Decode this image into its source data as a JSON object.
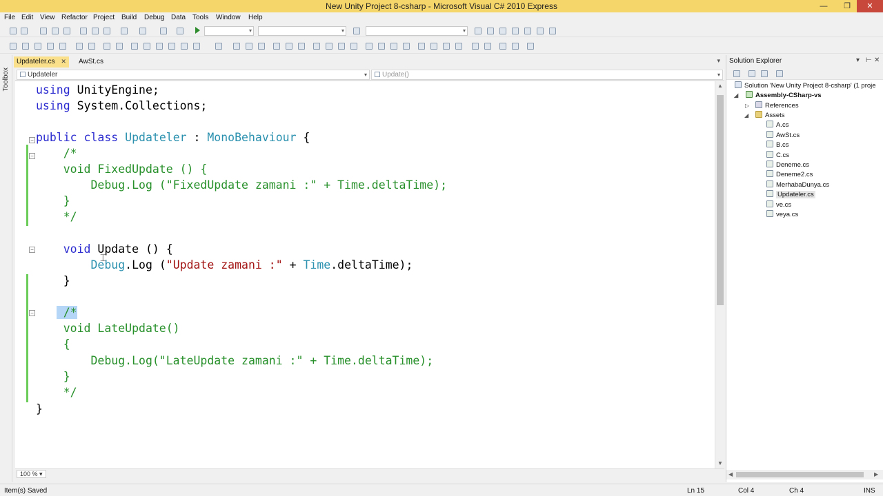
{
  "window": {
    "title": "New Unity Project 8-csharp - Microsoft Visual C# 2010 Express",
    "min": "—",
    "max": "❐",
    "close": "✕"
  },
  "menu": [
    "File",
    "Edit",
    "View",
    "Refactor",
    "Project",
    "Build",
    "Debug",
    "Data",
    "Tools",
    "Window",
    "Help"
  ],
  "toolbox": {
    "label": "Toolbox"
  },
  "tabs": [
    {
      "label": "Updateler.cs",
      "close": "✕",
      "active": true
    },
    {
      "label": "AwSt.cs",
      "active": false
    }
  ],
  "navbar": {
    "class_combo": "Updateler",
    "member_combo": "Update()"
  },
  "code": [
    [
      "using UnityEngine;"
    ],
    [
      "using System.Collections;"
    ],
    [
      ""
    ],
    [
      "public class Updateler : MonoBehaviour {"
    ],
    [
      "    /*"
    ],
    [
      "    void FixedUpdate () {"
    ],
    [
      "        Debug.Log (\"FixedUpdate zamani :\" + Time.deltaTime);"
    ],
    [
      "    }"
    ],
    [
      "    */"
    ],
    [
      ""
    ],
    [
      "    void Update () {"
    ],
    [
      "        Debug.Log (\"Update zamani :\" + Time.deltaTime);"
    ],
    [
      "    }"
    ],
    [
      ""
    ],
    [
      "    /*"
    ],
    [
      "    void LateUpdate()"
    ],
    [
      "    {"
    ],
    [
      "        Debug.Log(\"LateUpdate zamani :\" + Time.deltaTime);"
    ],
    [
      "    }"
    ],
    [
      "    */"
    ],
    [
      "}"
    ]
  ],
  "zoom": "100 %",
  "solution_explorer": {
    "title": "Solution Explorer",
    "pin": "⊢",
    "close": "✕",
    "solution": "Solution 'New Unity Project 8-csharp' (1 proje",
    "project": "Assembly-CSharp-vs",
    "references": "References",
    "assets": "Assets",
    "files": [
      "A.cs",
      "AwSt.cs",
      "B.cs",
      "C.cs",
      "Deneme.cs",
      "Deneme2.cs",
      "MerhabaDunya.cs",
      "Updateler.cs",
      "ve.cs",
      "veya.cs"
    ],
    "selected_file": "Updateler.cs"
  },
  "status": {
    "message": "Item(s) Saved",
    "ln": "Ln 15",
    "col": "Col 4",
    "ch": "Ch 4",
    "mode": "INS"
  },
  "colors": {
    "title_bar": "#f5d66b",
    "active_tab": "#fbe08c",
    "keyword": "#2b2bd0",
    "type": "#2b91af",
    "comment": "#27902a",
    "string": "#a31515",
    "change_marker": "#6ccc5a"
  }
}
